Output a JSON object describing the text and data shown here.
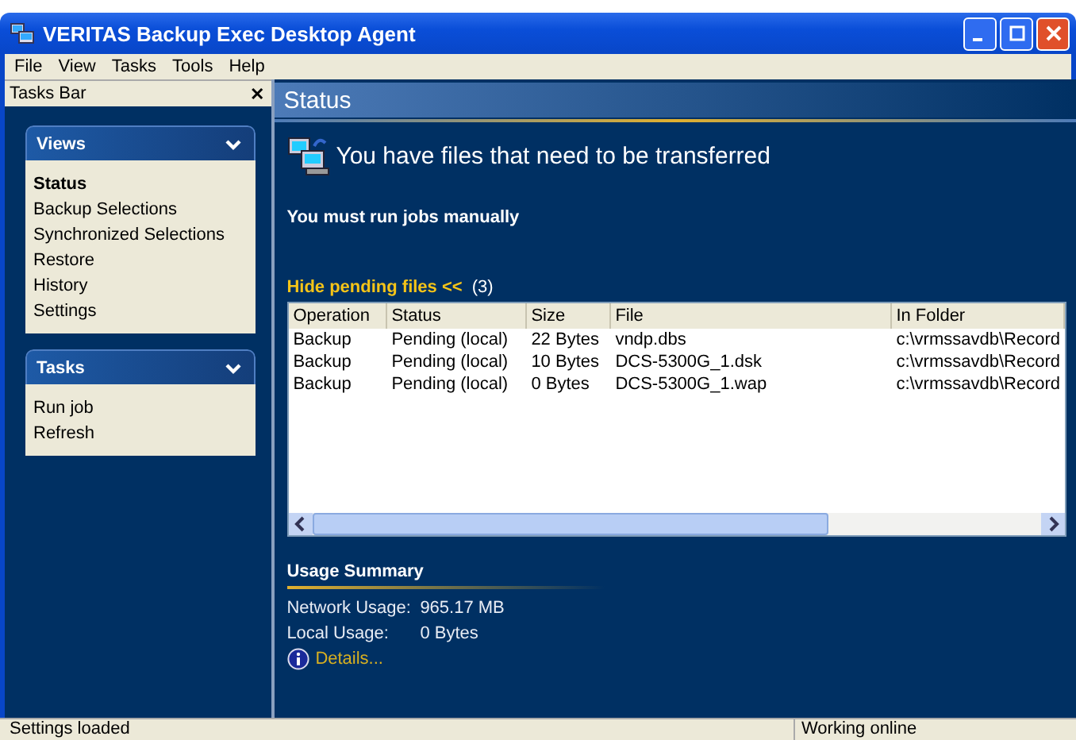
{
  "window": {
    "title": "VERITAS Backup Exec Desktop Agent"
  },
  "menu": [
    "File",
    "View",
    "Tasks",
    "Tools",
    "Help"
  ],
  "tasks_bar": {
    "title": "Tasks Bar",
    "close": "✕",
    "cards": [
      {
        "title": "Views",
        "expanded": true,
        "items": [
          {
            "label": "Status",
            "selected": true
          },
          {
            "label": "Backup Selections",
            "selected": false
          },
          {
            "label": "Synchronized Selections",
            "selected": false
          },
          {
            "label": "Restore",
            "selected": false
          },
          {
            "label": "History",
            "selected": false
          },
          {
            "label": "Settings",
            "selected": false
          }
        ]
      },
      {
        "title": "Tasks",
        "expanded": true,
        "items": [
          {
            "label": "Run job",
            "selected": false
          },
          {
            "label": "Refresh",
            "selected": false
          }
        ]
      }
    ]
  },
  "status_page": {
    "title": "Status",
    "headline": "You have files that need to be transferred",
    "message": "You must run jobs manually",
    "pending_toggle": "Hide pending files <<",
    "pending_count": "(3)",
    "table": {
      "columns": [
        "Operation",
        "Status",
        "Size",
        "File",
        "In Folder"
      ],
      "rows": [
        [
          "Backup",
          "Pending (local)",
          "22 Bytes",
          "vndp.dbs",
          "c:\\vrmssavdb\\Record"
        ],
        [
          "Backup",
          "Pending (local)",
          "10 Bytes",
          "DCS-5300G_1.dsk",
          "c:\\vrmssavdb\\Record"
        ],
        [
          "Backup",
          "Pending (local)",
          "0 Bytes",
          "DCS-5300G_1.wap",
          "c:\\vrmssavdb\\Record"
        ]
      ]
    },
    "usage": {
      "title": "Usage Summary",
      "rows": [
        {
          "label": "Network Usage:",
          "value": "965.17 MB"
        },
        {
          "label": "Local Usage:",
          "value": "0 Bytes"
        }
      ],
      "details": "Details..."
    }
  },
  "status_bar": [
    "Settings loaded",
    "Working online"
  ]
}
